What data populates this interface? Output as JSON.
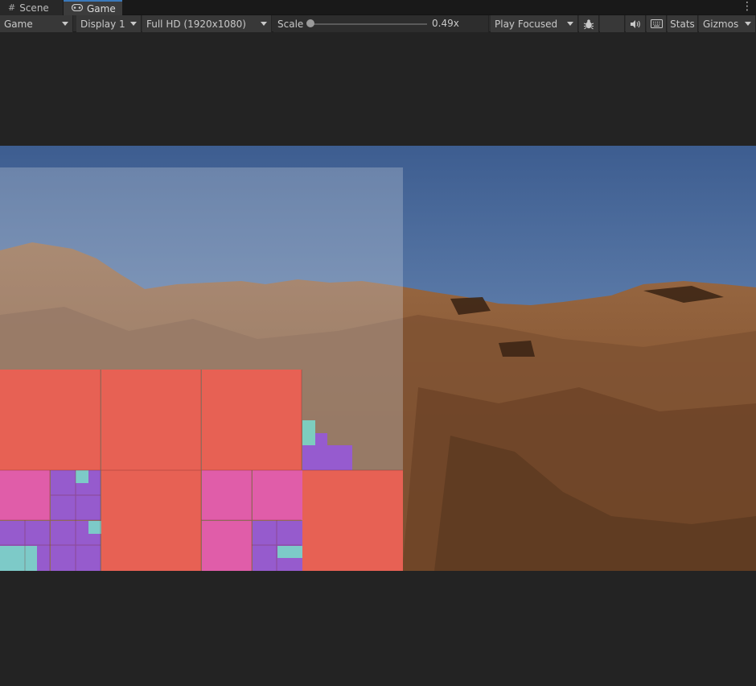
{
  "tabs": {
    "scene": {
      "label": "Scene",
      "icon": "grid-icon"
    },
    "game": {
      "label": "Game",
      "icon": "gamepad-icon"
    },
    "menu_icon": "kebab-menu-icon"
  },
  "toolbar": {
    "view_select": "Game",
    "display_select": "Display 1",
    "resolution_select": "Full HD (1920x1080)",
    "scale_label": "Scale",
    "scale_value": "0.49x",
    "scale_fraction": 0.49,
    "play_mode_select": "Play Focused",
    "bug_icon": "bug-icon",
    "audio_icon": "speaker-icon",
    "keyboard_icon": "keyboard-icon",
    "stats_label": "Stats",
    "gizmos_label": "Gizmos"
  },
  "colors": {
    "accent_tab": "#3a79bb",
    "overlay_red": "#ef5e52",
    "overlay_pink": "#e85ab0",
    "overlay_purple": "#9c58d8",
    "overlay_cyan": "#7ad6c8",
    "sky_top": "#3f5f91",
    "terrain": "#8a5a36"
  }
}
